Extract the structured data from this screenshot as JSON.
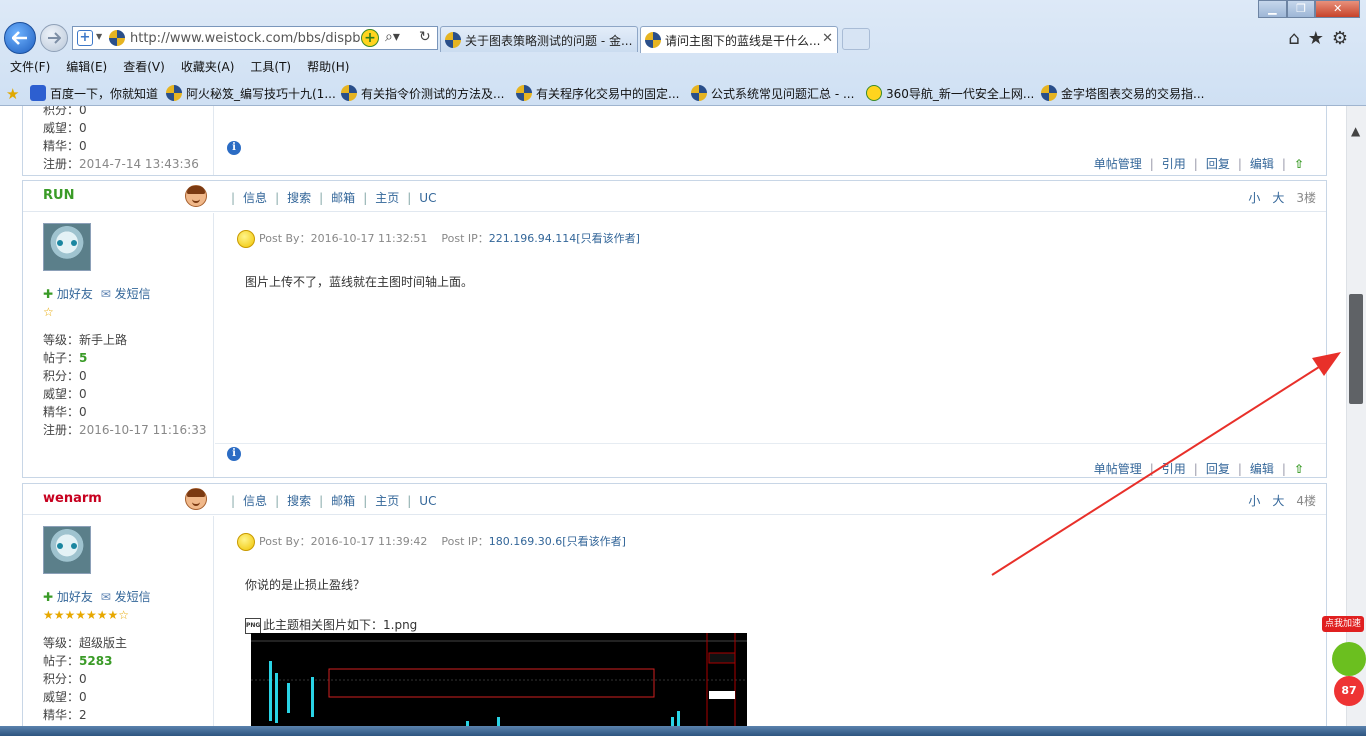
{
  "browser": {
    "address_url": "http://www.weistock.com/bbs/dispbbs.",
    "tabs": [
      {
        "label": "关于图表策略测试的问题 - 金..."
      },
      {
        "label": "请问主图下的蓝线是干什么..."
      }
    ],
    "menu": [
      "文件(F)",
      "编辑(E)",
      "查看(V)",
      "收藏夹(A)",
      "工具(T)",
      "帮助(H)"
    ],
    "favorites": [
      "百度一下，你就知道",
      "阿火秘笈_编写技巧十九(1...",
      "有关指令价测试的方法及...",
      "有关程序化交易中的固定...",
      "公式系统常见问题汇总 - ...",
      "360导航_新一代安全上网...",
      "金字塔图表交易的交易指..."
    ]
  },
  "post_prev": {
    "stats": [
      {
        "label": "积分：",
        "value": "0"
      },
      {
        "label": "威望：",
        "value": "0"
      },
      {
        "label": "精华：",
        "value": "0"
      },
      {
        "label": "注册：",
        "value": "2014-7-14 13:43:36"
      }
    ]
  },
  "common": {
    "head_links": [
      "信息",
      "搜索",
      "邮箱",
      "主页",
      "UC"
    ],
    "size_small": "小",
    "size_large": "大",
    "add_friend": "加好友",
    "send_msg": "发短信",
    "foot_links": [
      "单帖管理",
      "引用",
      "回复",
      "编辑"
    ],
    "post_by_label": "Post By：",
    "post_ip_label": "Post IP：",
    "only_author": "[只看该作者]"
  },
  "posts": [
    {
      "author": "RUN",
      "floor": "3楼",
      "stars": "☆",
      "stats": [
        {
          "label": "等级：",
          "value": "新手上路"
        },
        {
          "label": "帖子：",
          "value": "5"
        },
        {
          "label": "积分：",
          "value": "0"
        },
        {
          "label": "威望：",
          "value": "0"
        },
        {
          "label": "精华：",
          "value": "0"
        },
        {
          "label": "注册：",
          "value": "2016-10-17 11:16:33"
        }
      ],
      "post_time": "2016-10-17 11:32:51",
      "post_ip": "221.196.94.114",
      "body": "图片上传不了，蓝线就在主图时间轴上面。"
    },
    {
      "author": "wenarm",
      "floor": "4楼",
      "stars": "★★★★★★★☆",
      "stats": [
        {
          "label": "等级：",
          "value": "超级版主"
        },
        {
          "label": "帖子：",
          "value": "5283"
        },
        {
          "label": "积分：",
          "value": "0"
        },
        {
          "label": "威望：",
          "value": "0"
        },
        {
          "label": "精华：",
          "value": "2"
        }
      ],
      "post_time": "2016-10-17 11:39:42",
      "post_ip": "180.169.30.6",
      "body": "你说的是止损止盈线？",
      "attachment": "此主题相关图片如下：1.png"
    }
  ],
  "widget": {
    "speed_label": "点我加速",
    "speed_num": "87"
  }
}
